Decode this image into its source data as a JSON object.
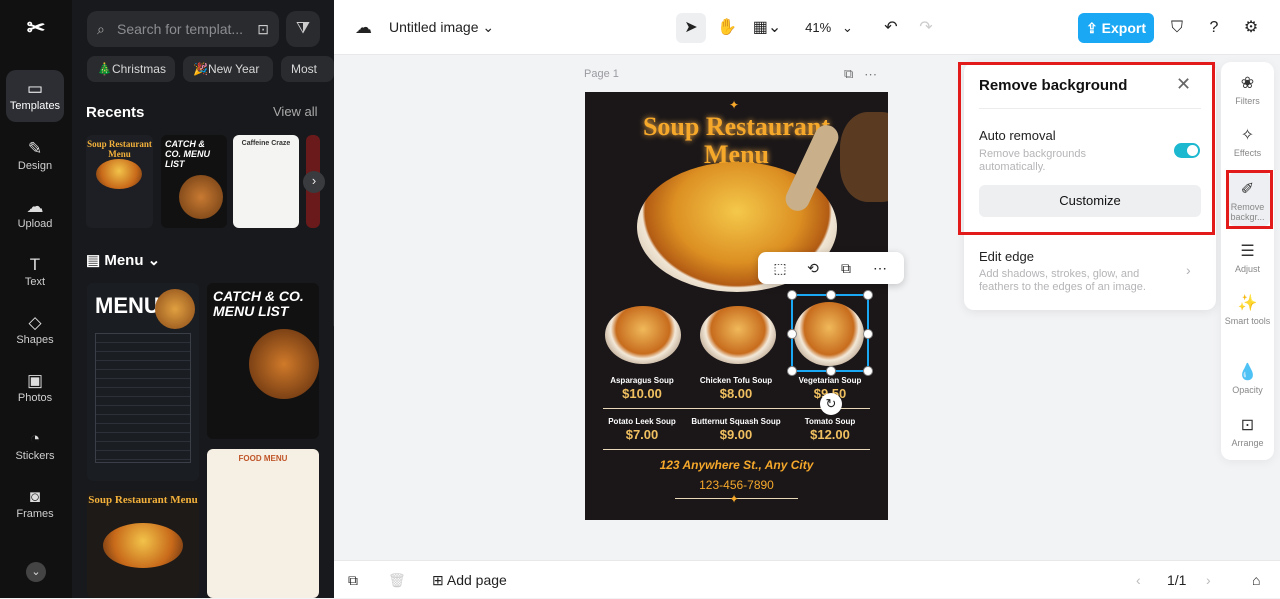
{
  "nav": {
    "items": [
      {
        "label": "Templates",
        "icon": "templates-icon"
      },
      {
        "label": "Design",
        "icon": "design-icon"
      },
      {
        "label": "Upload",
        "icon": "upload-icon"
      },
      {
        "label": "Text",
        "icon": "text-icon"
      },
      {
        "label": "Shapes",
        "icon": "shapes-icon"
      },
      {
        "label": "Photos",
        "icon": "photos-icon"
      },
      {
        "label": "Stickers",
        "icon": "stickers-icon"
      },
      {
        "label": "Frames",
        "icon": "frames-icon"
      }
    ]
  },
  "left_panel": {
    "search_placeholder": "Search for templat...",
    "chips": [
      "🎄Christmas",
      "🎉New Year",
      "Most"
    ],
    "recents_title": "Recents",
    "view_all": "View all",
    "menu_title": "Menu",
    "thumb_texts": {
      "soup": "Soup Restaurant Menu",
      "catch": "CATCH & CO. MENU LIST",
      "caffeine": "Caffeine Craze",
      "menu": "MENU",
      "food_menu": "FOOD MENU"
    }
  },
  "topbar": {
    "doc_title": "Untitled image",
    "zoom": "41%",
    "export_label": "Export"
  },
  "canvas": {
    "page_label": "Page 1",
    "poster": {
      "title_line1": "Soup Restaurant",
      "title_line2": "Menu",
      "items_row1": [
        {
          "name": "Asparagus Soup",
          "price": "$10.00"
        },
        {
          "name": "Chicken Tofu Soup",
          "price": "$8.00"
        },
        {
          "name": "Vegetarian Soup",
          "price": "$9.50"
        }
      ],
      "items_row2": [
        {
          "name": "Potato Leek Soup",
          "price": "$7.00"
        },
        {
          "name": "Butternut Squash Soup",
          "price": "$9.00"
        },
        {
          "name": "Tomato Soup",
          "price": "$12.00"
        }
      ],
      "address": "123 Anywhere St., Any City",
      "phone": "123-456-7890"
    }
  },
  "remove_bg_panel": {
    "title": "Remove background",
    "auto_label": "Auto removal",
    "auto_desc": "Remove backgrounds automatically.",
    "customize_label": "Customize",
    "edit_edge_label": "Edit edge",
    "edit_edge_desc": "Add shadows, strokes, glow, and feathers to the edges of an image.",
    "auto_enabled": true
  },
  "right_tools": [
    {
      "label": "Filters",
      "icon": "filters-icon"
    },
    {
      "label": "Effects",
      "icon": "effects-icon"
    },
    {
      "label": "Remove backgr...",
      "icon": "remove-background-icon"
    },
    {
      "label": "Adjust",
      "icon": "adjust-icon"
    },
    {
      "label": "Smart tools",
      "icon": "smart-tools-icon"
    },
    {
      "label": "Opacity",
      "icon": "opacity-icon"
    },
    {
      "label": "Arrange",
      "icon": "arrange-icon"
    }
  ],
  "bottombar": {
    "add_page": "Add page",
    "page_count": "1/1"
  },
  "colors": {
    "accent": "#1aa8f4",
    "highlight": "#e21a1a",
    "toggle_on": "#1cb8d0",
    "poster_gold": "#f6a82a"
  }
}
